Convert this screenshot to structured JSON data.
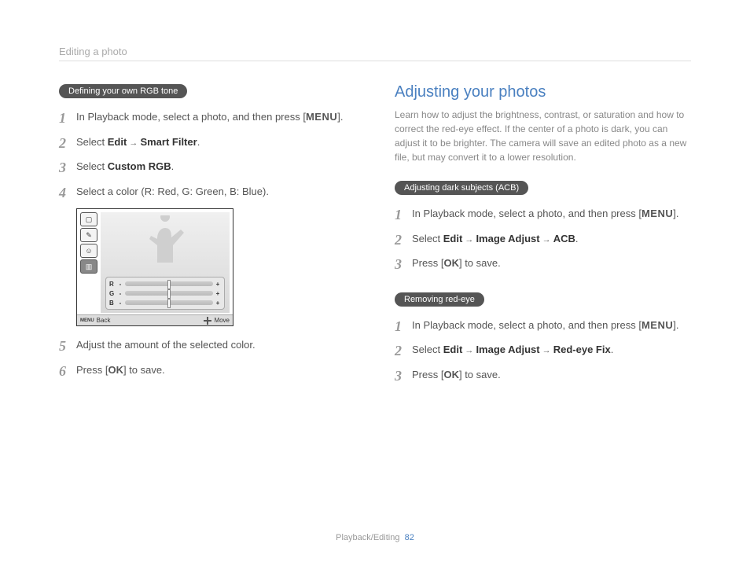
{
  "header": {
    "title": "Editing a photo"
  },
  "left": {
    "pill": "Defining your own RGB tone",
    "steps": {
      "s1_a": "In Playback mode, select a photo, and then press [",
      "s1_menu": "MENU",
      "s1_b": "].",
      "s2_a": "Select ",
      "s2_edit": "Edit",
      "s2_arrow": " → ",
      "s2_sf": "Smart Filter",
      "s2_end": ".",
      "s3_a": "Select ",
      "s3_crgb": "Custom RGB",
      "s3_end": ".",
      "s4": "Select a color (R: Red, G: Green, B: Blue).",
      "s5": "Adjust the amount of the selected color.",
      "s6_a": "Press [",
      "s6_ok": "OK",
      "s6_b": "] to save."
    },
    "diagram": {
      "rgb": {
        "r": "R",
        "g": "G",
        "b": "B",
        "minus": "-",
        "plus": "+"
      },
      "footer": {
        "back_prefix": "MENU",
        "back": "Back",
        "move": "Move"
      }
    }
  },
  "right": {
    "title": "Adjusting your photos",
    "intro": "Learn how to adjust the brightness, contrast, or saturation and how to correct the red-eye effect. If the center of a photo is dark, you can adjust it to be brighter. The camera will save an edited photo as a new file, but may convert it to a lower resolution.",
    "acb": {
      "pill": "Adjusting dark subjects (ACB)",
      "s1_a": "In Playback mode, select a photo, and then press [",
      "s1_menu": "MENU",
      "s1_b": "].",
      "s2_a": "Select ",
      "s2_edit": "Edit",
      "s2_arrow1": " → ",
      "s2_ia": "Image Adjust",
      "s2_arrow2": " → ",
      "s2_acb": "ACB",
      "s2_end": ".",
      "s3_a": "Press [",
      "s3_ok": "OK",
      "s3_b": "] to save."
    },
    "redeye": {
      "pill": "Removing red-eye",
      "s1_a": "In Playback mode, select a photo, and then press [",
      "s1_menu": "MENU",
      "s1_b": "].",
      "s2_a": "Select ",
      "s2_edit": "Edit",
      "s2_arrow1": " → ",
      "s2_ia": "Image Adjust",
      "s2_arrow2": " → ",
      "s2_ref": "Red-eye Fix",
      "s2_end": ".",
      "s3_a": "Press [",
      "s3_ok": "OK",
      "s3_b": "] to save."
    }
  },
  "footer": {
    "section": "Playback/Editing",
    "page": "82"
  }
}
